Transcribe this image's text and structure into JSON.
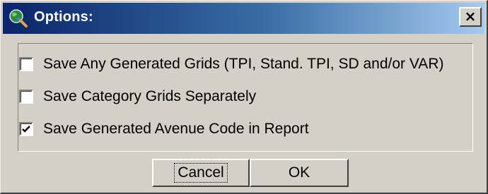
{
  "window": {
    "title": "Options:",
    "close_label": "×",
    "title_icon": "globe-magnifier-icon"
  },
  "options": [
    {
      "label": "Save Any Generated Grids (TPI, Stand. TPI, SD and/or VAR)",
      "checked": false
    },
    {
      "label": "Save Category Grids Separately",
      "checked": false
    },
    {
      "label": "Save Generated Avenue Code in Report",
      "checked": true
    }
  ],
  "buttons": {
    "cancel_label": "Cancel",
    "ok_label": "OK"
  },
  "colors": {
    "face": "#d4d0c8",
    "title_start": "#0a246a",
    "title_end": "#a6caf0"
  }
}
